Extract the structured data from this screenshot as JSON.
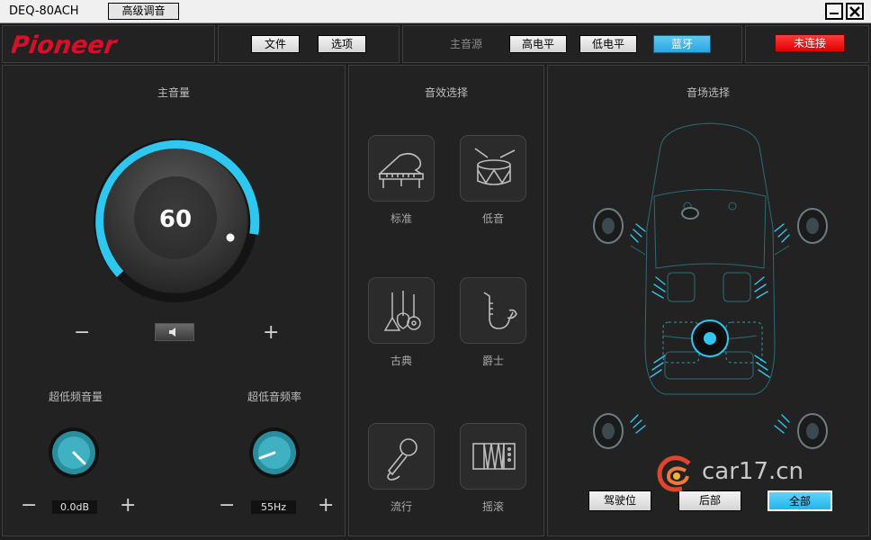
{
  "window": {
    "title": "DEQ-80ACH",
    "advanced_button": "高级调音"
  },
  "header": {
    "brand": "Pioneer",
    "menu": {
      "file": "文件",
      "options": "选项"
    },
    "source": {
      "label": "主音源",
      "high_level": "高电平",
      "low_level": "低电平",
      "bluetooth": "蓝牙",
      "selected": "bluetooth"
    },
    "status": "未连接"
  },
  "volume": {
    "title": "主音量",
    "value": "60",
    "minus": "−",
    "plus": "+"
  },
  "subwoofer": {
    "volume": {
      "label": "超低频音量",
      "value": "0.0dB"
    },
    "frequency": {
      "label": "超低音频率",
      "value": "55Hz"
    }
  },
  "effects": {
    "title": "音效选择",
    "items": [
      {
        "label": "标准",
        "icon": "piano-icon"
      },
      {
        "label": "低音",
        "icon": "drum-icon"
      },
      {
        "label": "古典",
        "icon": "guitars-icon"
      },
      {
        "label": "爵士",
        "icon": "saxophone-icon"
      },
      {
        "label": "流行",
        "icon": "microphone-icon"
      },
      {
        "label": "摇滚",
        "icon": "accordion-icon"
      }
    ]
  },
  "soundfield": {
    "title": "音场选择",
    "buttons": {
      "driver": "驾驶位",
      "rear": "后部",
      "all": "全部"
    },
    "selected": "all"
  },
  "watermark": {
    "text": "car17.cn"
  },
  "colors": {
    "accent": "#2ec7ef",
    "brand_red": "#d6102b",
    "status_red": "#ff1a1a",
    "background": "#1f1f1f"
  }
}
